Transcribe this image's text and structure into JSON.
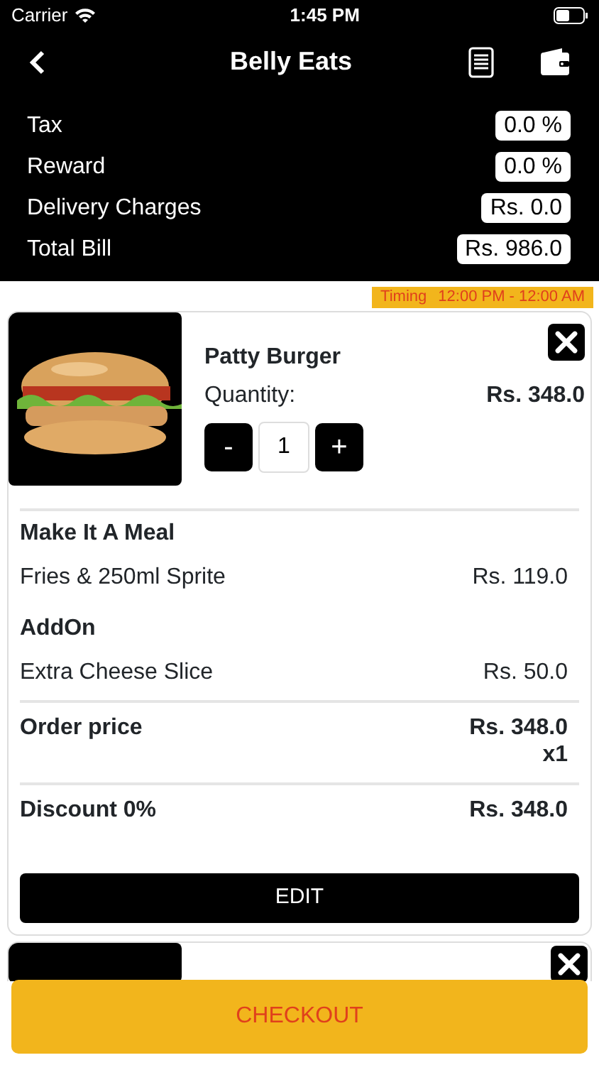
{
  "status_bar": {
    "carrier": "Carrier",
    "time": "1:45 PM"
  },
  "nav": {
    "title": "Belly Eats"
  },
  "summary": [
    {
      "label": "Tax",
      "value": "0.0 %"
    },
    {
      "label": "Reward",
      "value": "0.0 %"
    },
    {
      "label": "Delivery Charges",
      "value": "Rs. 0.0"
    },
    {
      "label": "Total Bill",
      "value": "Rs. 986.0"
    }
  ],
  "timing": {
    "label": "Timing",
    "hours": "12:00 PM - 12:00 AM"
  },
  "cart_item": {
    "name": "Patty Burger",
    "quantity_label": "Quantity:",
    "price": "Rs. 348.0",
    "minus": "-",
    "quantity": "1",
    "plus": "+",
    "sections": [
      {
        "heading": "Make It A Meal",
        "options": [
          {
            "name": "Fries & 250ml Sprite",
            "price": "Rs. 119.0"
          }
        ]
      },
      {
        "heading": "AddOn",
        "options": [
          {
            "name": "Extra Cheese Slice",
            "price": "Rs. 50.0"
          }
        ]
      }
    ],
    "order_price_label": "Order price",
    "order_price": "Rs. 348.0",
    "multiplier": "x1",
    "discount_label": "Discount 0%",
    "discount_price": "Rs. 348.0",
    "edit_label": "EDIT"
  },
  "checkout": {
    "label": "CHECKOUT"
  }
}
